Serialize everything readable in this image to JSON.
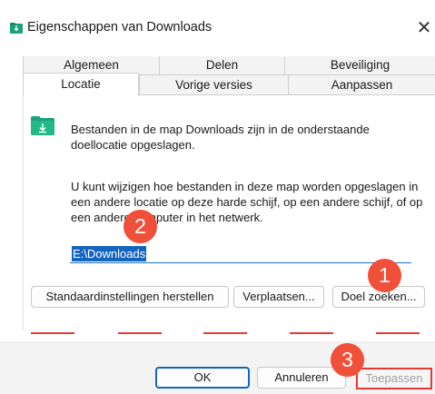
{
  "window": {
    "title": "Eigenschappen van Downloads",
    "close_glyph": "✕"
  },
  "tabs": {
    "row1": [
      "Algemeen",
      "Delen",
      "Beveiliging"
    ],
    "row2": [
      "Locatie",
      "Vorige versies",
      "Aanpassen"
    ],
    "active": "Locatie"
  },
  "content": {
    "icon": "downloads-folder-icon",
    "description": "Bestanden in de map Downloads zijn in de onderstaande doellocatie opgeslagen.",
    "info": "U kunt wijzigen hoe bestanden in deze map worden opgeslagen in een andere locatie op deze harde schijf, op een andere schijf, of op een andere computer in het netwerk.",
    "path_value": "E:\\Downloads"
  },
  "buttons": {
    "restore": "Standaardinstellingen herstellen",
    "move": "Verplaatsen...",
    "find_target": "Doel zoeken..."
  },
  "footer": {
    "ok": "OK",
    "cancel": "Annuleren",
    "apply": "Toepassen"
  },
  "markers": [
    "1",
    "2",
    "3"
  ],
  "colors": {
    "accent": "#1565c0",
    "marker": "#f0503a",
    "highlight_border": "#e53935",
    "folder_icon": "#1aa37a"
  }
}
